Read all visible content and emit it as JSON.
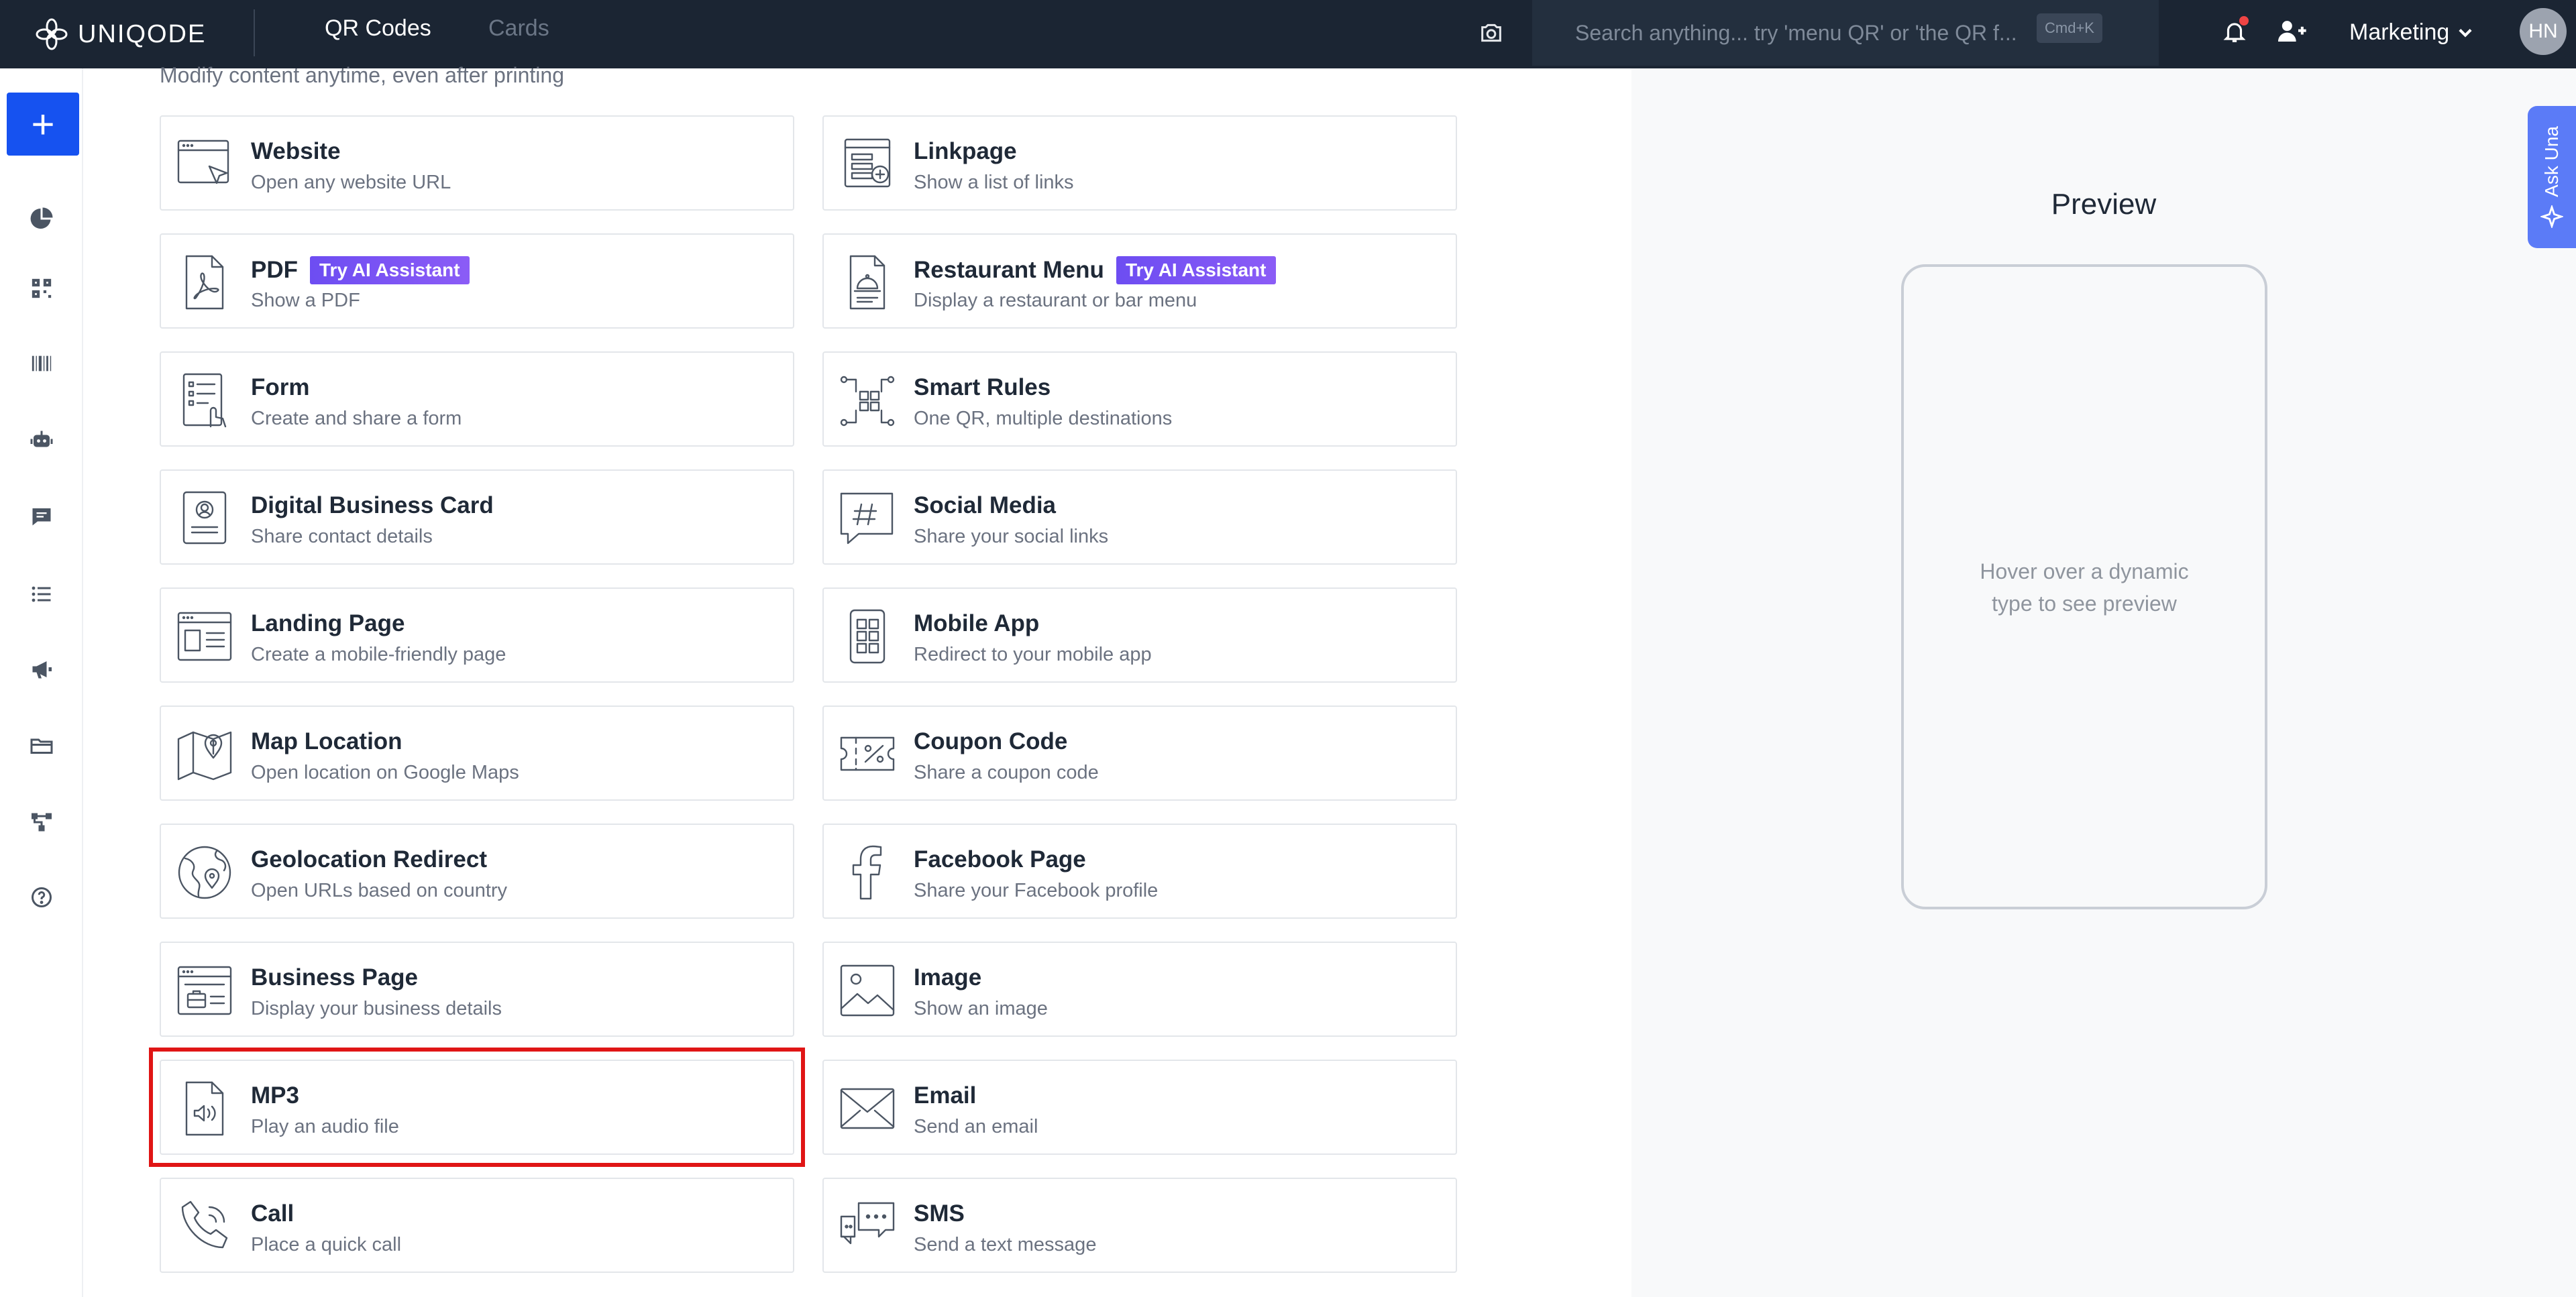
{
  "brand": {
    "name": "UNIQODE"
  },
  "nav": {
    "tabs": [
      {
        "label": "QR Codes",
        "active": true
      },
      {
        "label": "Cards",
        "active": false
      }
    ]
  },
  "search": {
    "placeholder": "Search anything... try 'menu QR' or 'the QR f...",
    "shortcut": "Cmd+K"
  },
  "topbar": {
    "workspace": "Marketing",
    "avatar_initials": "HN",
    "notification_dot_color": "#ef4444"
  },
  "sidebar": {
    "create_label": "+",
    "icons": [
      "analytics-icon",
      "qr-codes-icon",
      "barcode-icon",
      "bot-icon",
      "messages-icon",
      "list-icon",
      "campaign-icon",
      "folder-icon",
      "workflow-icon",
      "help-icon"
    ]
  },
  "main": {
    "subtitle": "Modify content anytime, even after printing",
    "cards": [
      {
        "id": "website",
        "title": "Website",
        "desc": "Open any website URL",
        "icon": "browser-cursor-icon",
        "badge": ""
      },
      {
        "id": "linkpage",
        "title": "Linkpage",
        "desc": "Show a list of links",
        "icon": "linkpage-icon",
        "badge": ""
      },
      {
        "id": "pdf",
        "title": "PDF",
        "desc": "Show a PDF",
        "icon": "pdf-icon",
        "badge": "Try AI Assistant"
      },
      {
        "id": "restaurant-menu",
        "title": "Restaurant Menu",
        "desc": "Display a restaurant or bar menu",
        "icon": "menu-cloche-icon",
        "badge": "Try AI Assistant"
      },
      {
        "id": "form",
        "title": "Form",
        "desc": "Create and share a form",
        "icon": "form-icon",
        "badge": ""
      },
      {
        "id": "smart-rules",
        "title": "Smart Rules",
        "desc": "One QR, multiple destinations",
        "icon": "smart-rules-icon",
        "badge": ""
      },
      {
        "id": "digital-business-card",
        "title": "Digital Business Card",
        "desc": "Share contact details",
        "icon": "contact-card-icon",
        "badge": ""
      },
      {
        "id": "social-media",
        "title": "Social Media",
        "desc": "Share your social links",
        "icon": "hashtag-icon",
        "badge": ""
      },
      {
        "id": "landing-page",
        "title": "Landing Page",
        "desc": "Create a mobile-friendly page",
        "icon": "landing-page-icon",
        "badge": ""
      },
      {
        "id": "mobile-app",
        "title": "Mobile App",
        "desc": "Redirect to your mobile app",
        "icon": "mobile-app-icon",
        "badge": ""
      },
      {
        "id": "map-location",
        "title": "Map Location",
        "desc": "Open location on Google Maps",
        "icon": "map-pin-icon",
        "badge": ""
      },
      {
        "id": "coupon-code",
        "title": "Coupon Code",
        "desc": "Share a coupon code",
        "icon": "coupon-icon",
        "badge": ""
      },
      {
        "id": "geolocation-redirect",
        "title": "Geolocation Redirect",
        "desc": "Open URLs based on country",
        "icon": "globe-pin-icon",
        "badge": ""
      },
      {
        "id": "facebook-page",
        "title": "Facebook Page",
        "desc": "Share your Facebook profile",
        "icon": "facebook-icon",
        "badge": ""
      },
      {
        "id": "business-page",
        "title": "Business Page",
        "desc": "Display your business details",
        "icon": "business-page-icon",
        "badge": ""
      },
      {
        "id": "image",
        "title": "Image",
        "desc": "Show an image",
        "icon": "image-icon",
        "badge": ""
      },
      {
        "id": "mp3",
        "title": "MP3",
        "desc": "Play an audio file",
        "icon": "audio-file-icon",
        "badge": ""
      },
      {
        "id": "email",
        "title": "Email",
        "desc": "Send an email",
        "icon": "envelope-icon",
        "badge": ""
      },
      {
        "id": "call",
        "title": "Call",
        "desc": "Place a quick call",
        "icon": "phone-icon",
        "badge": ""
      },
      {
        "id": "sms",
        "title": "SMS",
        "desc": "Send a text message",
        "icon": "sms-icon",
        "badge": ""
      }
    ],
    "highlighted_card": "mp3"
  },
  "preview": {
    "title": "Preview",
    "hint": "Hover over a dynamic type to see preview"
  },
  "assistant": {
    "label": "Ask Una"
  },
  "colors": {
    "topbar": "#1b2533",
    "primary": "#1652f0",
    "ai_badge": "#7c3aed",
    "highlight": "#e01515",
    "assistant": "#5b7bf7"
  }
}
